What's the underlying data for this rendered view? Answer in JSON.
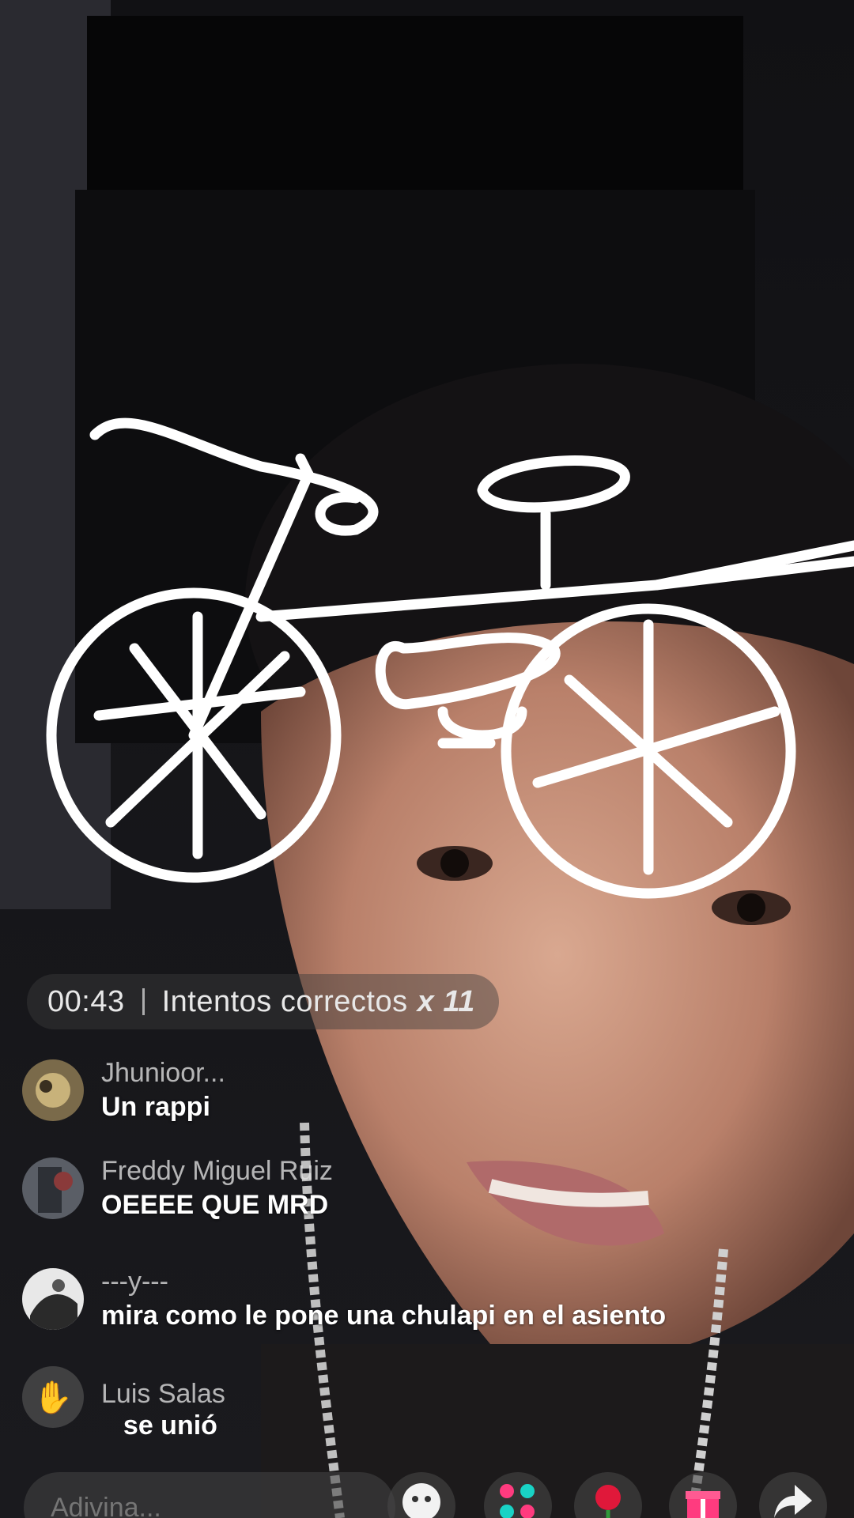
{
  "game": {
    "timer": "00:43",
    "attempts_label": "Intentos correctos",
    "attempts_count": "x 11"
  },
  "comments": [
    {
      "user": "Jhunioor...",
      "message": "Un rappi"
    },
    {
      "user": "Freddy Miguel Ruiz",
      "message": "OEEEE QUE MRD"
    },
    {
      "user": "---y---",
      "message": "mira como le pone una chulapi en el asiento"
    }
  ],
  "join_notice": {
    "user": "Luis Salas",
    "text": "se unió"
  },
  "input": {
    "placeholder": "Adivina..."
  },
  "actions": [
    {
      "name": "emoji-button",
      "icon": "smiley-icon"
    },
    {
      "name": "games-button",
      "icon": "dots-icon"
    },
    {
      "name": "rose-gift-button",
      "icon": "rose-icon"
    },
    {
      "name": "gift-button",
      "icon": "gift-icon"
    },
    {
      "name": "share-button",
      "icon": "share-arrow-icon"
    }
  ],
  "colors": {
    "background": "#0b0b0d",
    "drawing_stroke": "#ffffff",
    "overlay": "#464646"
  }
}
